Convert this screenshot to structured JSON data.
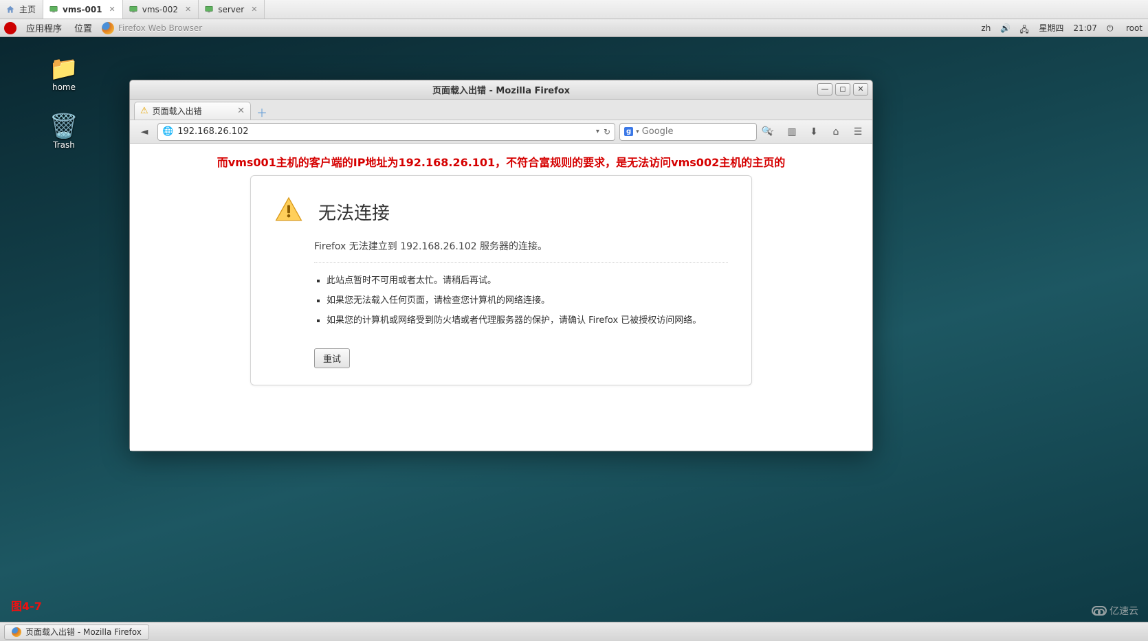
{
  "vm_tabs": [
    {
      "label": "主页",
      "icon": "home",
      "active": false
    },
    {
      "label": "vms-001",
      "icon": "monitor",
      "active": true
    },
    {
      "label": "vms-002",
      "icon": "monitor",
      "active": false
    },
    {
      "label": "server",
      "icon": "monitor",
      "active": false
    }
  ],
  "menubar": {
    "apps": "应用程序",
    "places": "位置",
    "ffx": "Firefox Web Browser",
    "right": {
      "lang": "zh",
      "day": "星期四",
      "time": "21:07",
      "user": "root"
    }
  },
  "desktop": {
    "home": "home",
    "trash": "Trash"
  },
  "annotation": "而vms001主机的客户端的IP地址为192.168.26.101，不符合富规则的要求，是无法访问vms002主机的主页的",
  "figlabel": "图4-7",
  "watermark": "亿速云",
  "firefox": {
    "window_title": "页面载入出错  -  Mozilla Firefox",
    "tab_title": "页面载入出错",
    "url": "192.168.26.102",
    "search_placeholder": "Google",
    "error": {
      "title": "无法连接",
      "subtitle": "Firefox 无法建立到 192.168.26.102 服务器的连接。",
      "bullets": [
        "此站点暂时不可用或者太忙。请稍后再试。",
        "如果您无法载入任何页面，请检查您计算机的网络连接。",
        "如果您的计算机或网络受到防火墙或者代理服务器的保护，请确认 Firefox 已被授权访问网络。"
      ],
      "retry": "重试"
    }
  },
  "taskbar": {
    "active": "页面载入出错 - Mozilla Firefox"
  }
}
